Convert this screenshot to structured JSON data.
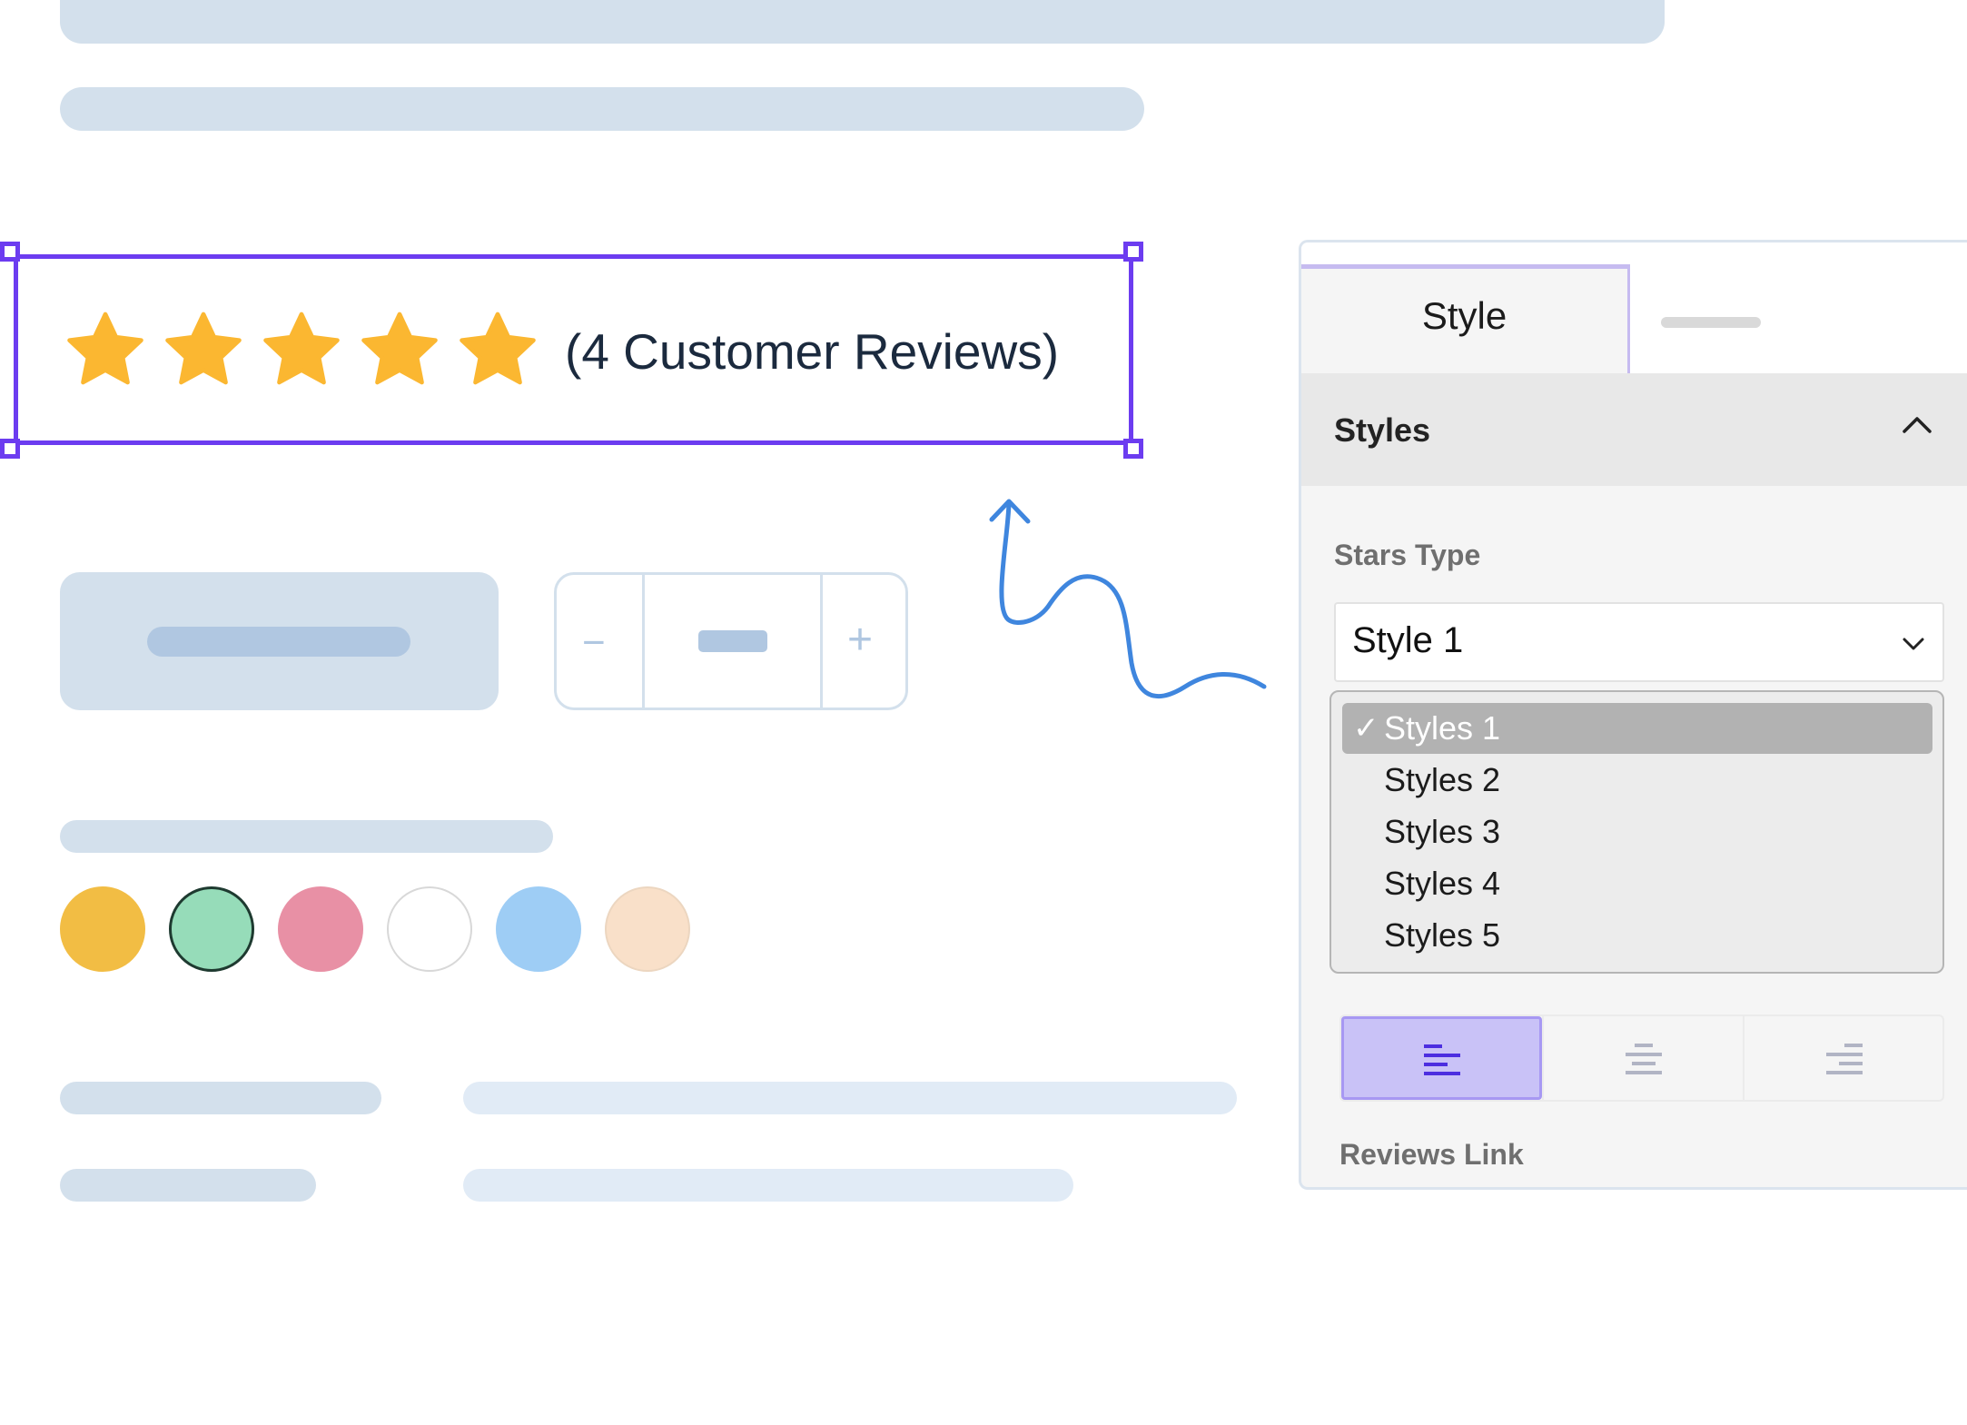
{
  "rating": {
    "star_count": 5,
    "reviews_text": "(4 Customer Reviews)",
    "star_color": "#fbb731"
  },
  "swatches": [
    {
      "name": "yellow",
      "color": "#f2bd44",
      "selected": false
    },
    {
      "name": "green",
      "color": "#96dcb9",
      "selected": true
    },
    {
      "name": "pink",
      "color": "#e890a5",
      "selected": false
    },
    {
      "name": "white",
      "color": "#ffffff",
      "selected": false
    },
    {
      "name": "blue",
      "color": "#9ecdf5",
      "selected": false
    },
    {
      "name": "peach",
      "color": "#f9e0c9",
      "selected": false
    }
  ],
  "panel": {
    "tabs": [
      {
        "label": "Style",
        "active": true
      },
      {
        "label": "",
        "active": false
      }
    ],
    "section_title": "Styles",
    "stars_type_label": "Stars Type",
    "select_value": "Style 1",
    "options": [
      "Styles 1",
      "Styles 2",
      "Styles 3",
      "Styles 4",
      "Styles 5"
    ],
    "selected_option": "Styles 1",
    "checkmark": "✓",
    "alignment": {
      "options": [
        "left",
        "center",
        "right"
      ],
      "selected": "left"
    },
    "reviews_link_label": "Reviews Link"
  },
  "colors": {
    "accent": "#6c3cf0",
    "arrow": "#3f86de",
    "placeholder": "#d3e0ec"
  }
}
